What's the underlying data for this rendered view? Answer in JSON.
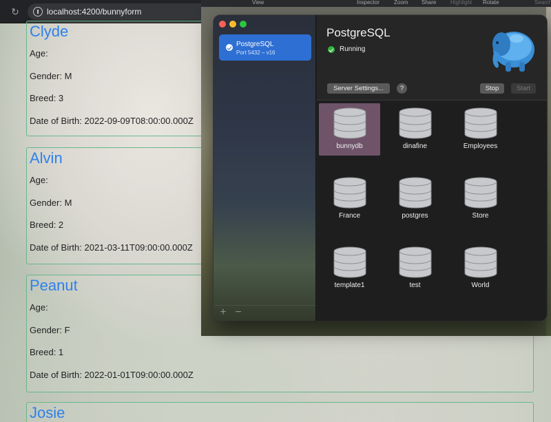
{
  "browser": {
    "url": "localhost:4200/bunnyform"
  },
  "bunnies": [
    {
      "name": "Clyde",
      "age": "Age:",
      "gender": "Gender: M",
      "breed": "Breed: 3",
      "dob": "Date of Birth: 2022-09-09T08:00:00.000Z"
    },
    {
      "name": "Alvin",
      "age": "Age:",
      "gender": "Gender: M",
      "breed": "Breed: 2",
      "dob": "Date of Birth: 2021-03-11T09:00:00.000Z"
    },
    {
      "name": "Peanut",
      "age": "Age:",
      "gender": "Gender: F",
      "breed": "Breed: 1",
      "dob": "Date of Birth: 2022-01-01T09:00:00.000Z"
    },
    {
      "name": "Josie"
    }
  ],
  "menubar": {
    "items": [
      "View",
      "Inspector",
      "Zoom",
      "Share",
      "Highlight",
      "Rotate",
      "Search"
    ]
  },
  "postgres_app": {
    "server": {
      "name": "PostgreSQL",
      "port": "Port 5432 – v16"
    },
    "title": "PostgreSQL",
    "status": "Running",
    "buttons": {
      "server_settings": "Server Settings...",
      "help": "?",
      "stop": "Stop",
      "start": "Start"
    },
    "sidebar_footer": {
      "add": "+",
      "remove": "−"
    },
    "databases": [
      "bunnydb",
      "dinafine",
      "Employees",
      "France",
      "postgres",
      "Store",
      "template1",
      "test",
      "World"
    ],
    "selected_database": "bunnydb"
  },
  "colors": {
    "accent_blue": "#2e6fd4",
    "running_green": "#31b43e",
    "selected_tile": "#6e5369",
    "bunny_name": "#2f80ed",
    "card_border": "#68b78a"
  }
}
